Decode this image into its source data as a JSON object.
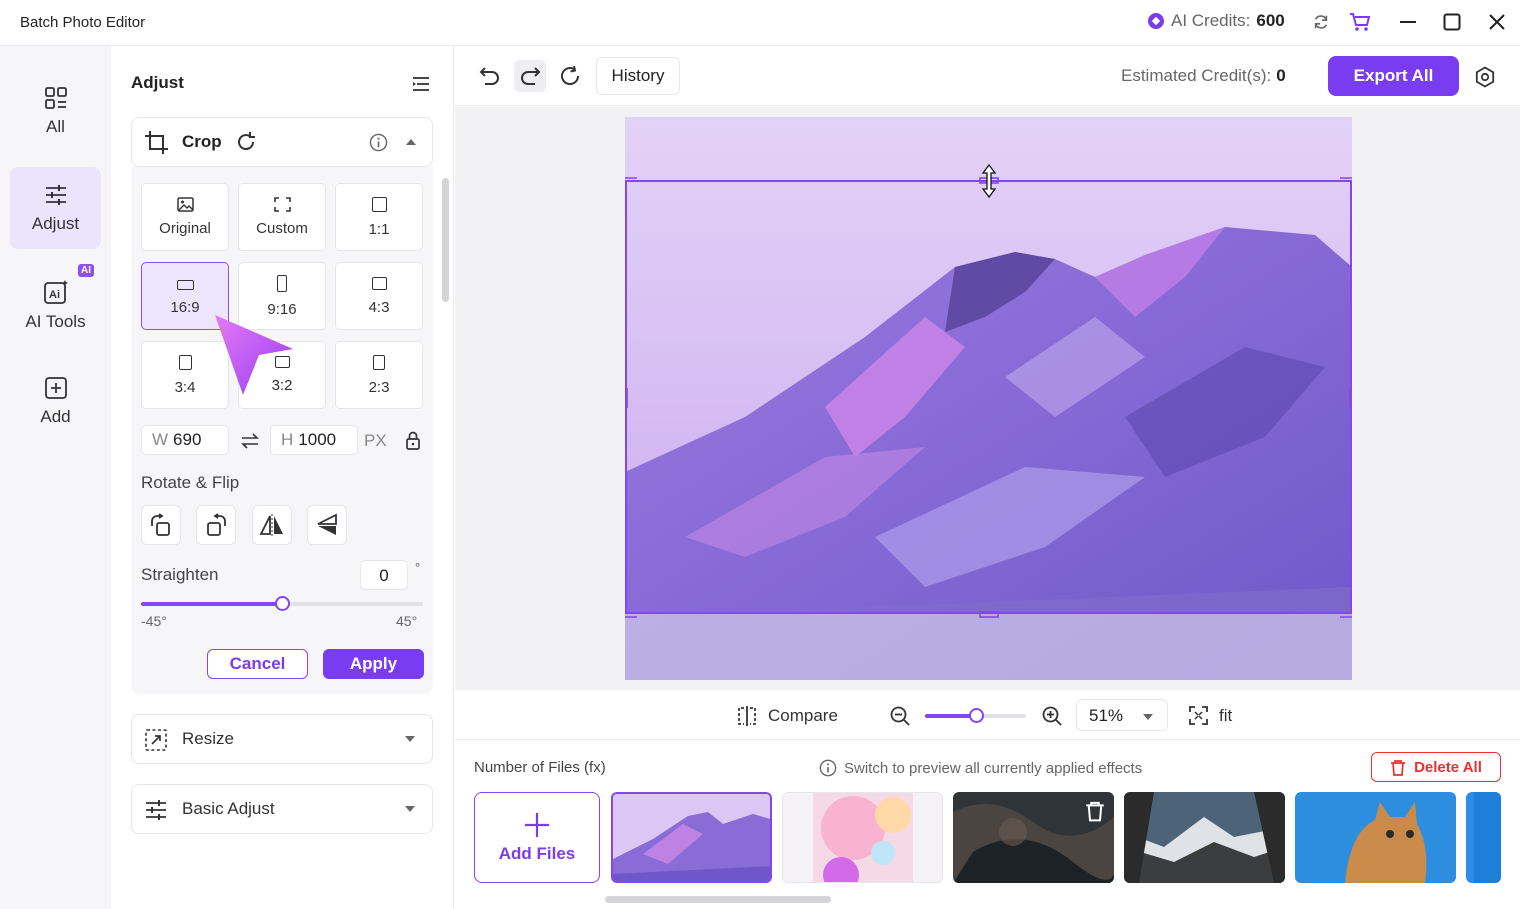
{
  "window": {
    "title": "Batch Photo Editor",
    "credits_label": "AI Credits:",
    "credits_value": "600"
  },
  "leftnav": {
    "items": [
      {
        "label": "All",
        "icon": "grid-icon"
      },
      {
        "label": "Adjust",
        "icon": "sliders-icon",
        "active": true
      },
      {
        "label": "AI Tools",
        "icon": "ai-icon",
        "badge": "AI"
      },
      {
        "label": "Add",
        "icon": "plus-square-icon"
      }
    ]
  },
  "panel": {
    "title": "Adjust",
    "crop": {
      "label": "Crop",
      "ratios": [
        "Original",
        "Custom",
        "1:1",
        "16:9",
        "9:16",
        "4:3",
        "3:4",
        "3:2",
        "2:3"
      ],
      "selected_ratio": "16:9",
      "width_key": "W",
      "width_value": "690",
      "height_key": "H",
      "height_value": "1000",
      "unit": "PX",
      "rotate_flip_label": "Rotate & Flip",
      "straighten_label": "Straighten",
      "straighten_value": "0",
      "degree_symbol": "°",
      "straighten_level": 0.5,
      "range_min": "-45°",
      "range_max": "45°",
      "cancel_label": "Cancel",
      "apply_label": "Apply"
    },
    "sections": [
      {
        "label": "Resize",
        "icon": "resize-icon"
      },
      {
        "label": "Basic Adjust",
        "icon": "sliders-icon"
      }
    ]
  },
  "toolbar": {
    "history_label": "History",
    "estimated_label": "Estimated Credit(s):",
    "estimated_value": "0",
    "export_label": "Export All"
  },
  "viewer": {
    "compare_label": "Compare",
    "zoom_value": "51%",
    "zoom_level": 0.5,
    "fit_label": "fit"
  },
  "files": {
    "count_label": "Number of Files (fx)",
    "hint": "Switch to preview all currently applied effects",
    "delete_label": "Delete All",
    "add_label": "Add Files"
  },
  "colors": {
    "accent": "#7a3cf0",
    "danger": "#e63232"
  }
}
